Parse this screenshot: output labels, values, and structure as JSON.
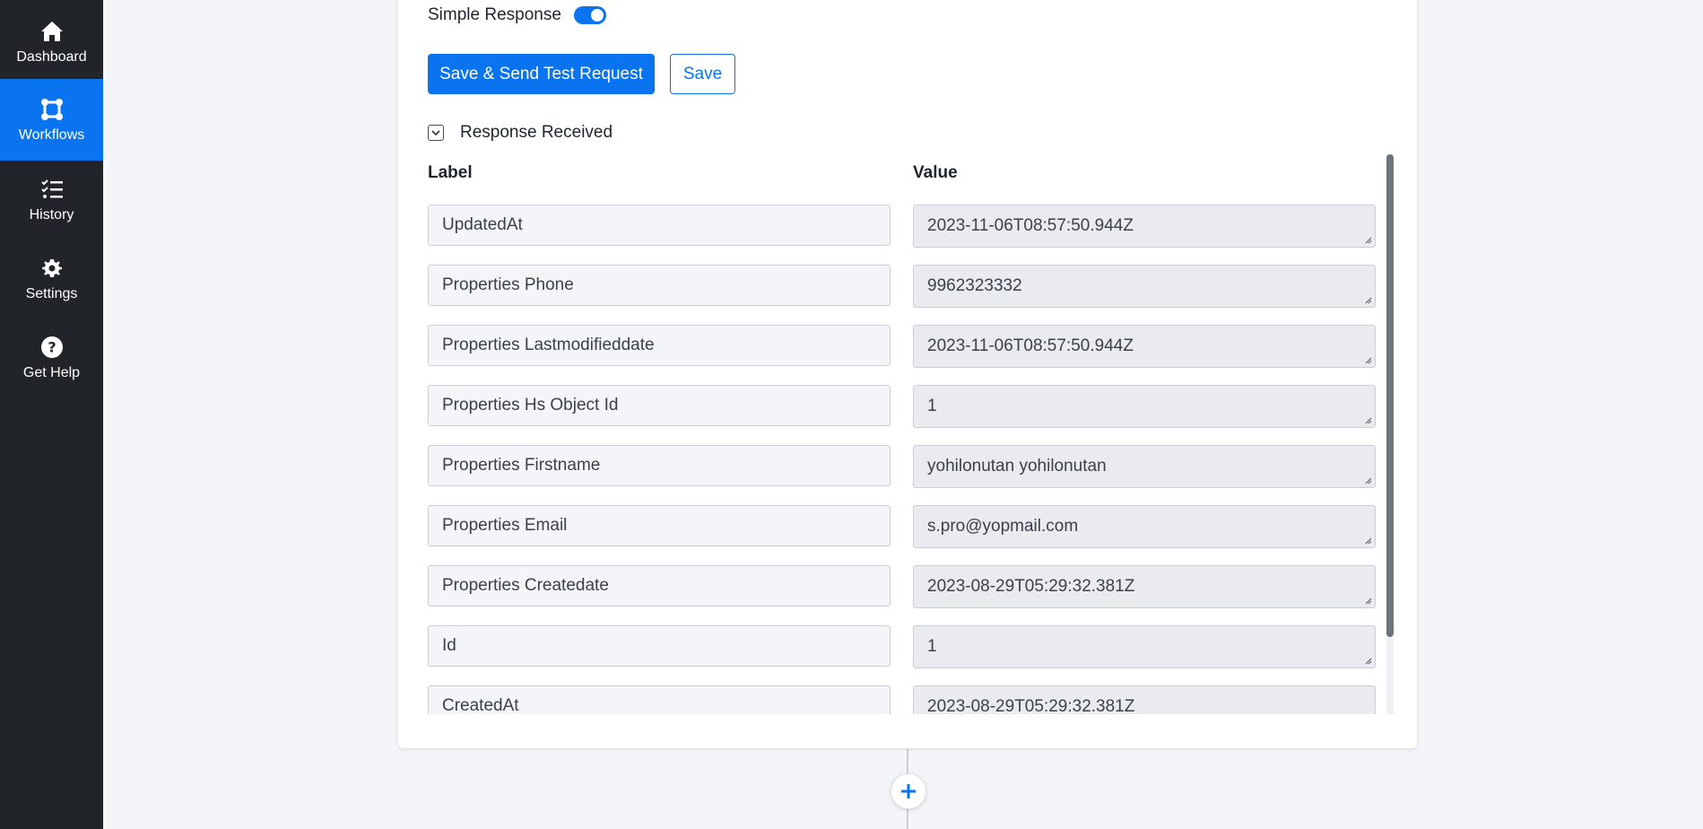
{
  "sidebar": {
    "items": [
      {
        "label": "Dashboard",
        "icon": "home-icon",
        "active": false
      },
      {
        "label": "Workflows",
        "icon": "workflows-icon",
        "active": true
      },
      {
        "label": "History",
        "icon": "history-icon",
        "active": false
      },
      {
        "label": "Settings",
        "icon": "gear-icon",
        "active": false
      },
      {
        "label": "Get Help",
        "icon": "help-icon",
        "active": false
      }
    ],
    "active_color": "#0a73f0",
    "background": "#212529"
  },
  "form": {
    "simple_response_label": "Simple Response",
    "simple_response_on": true,
    "save_send_label": "Save & Send Test Request",
    "save_label": "Save",
    "response_received_label": "Response Received"
  },
  "table": {
    "headers": {
      "label": "Label",
      "value": "Value"
    },
    "rows": [
      {
        "label": "UpdatedAt",
        "value": "2023-11-06T08:57:50.944Z"
      },
      {
        "label": "Properties Phone",
        "value": "9962323332"
      },
      {
        "label": "Properties Lastmodifieddate",
        "value": "2023-11-06T08:57:50.944Z"
      },
      {
        "label": "Properties Hs Object Id",
        "value": "1"
      },
      {
        "label": "Properties Firstname",
        "value": "yohilonutan yohilonutan"
      },
      {
        "label": "Properties Email",
        "value": "s.pro@yopmail.com"
      },
      {
        "label": "Properties Createdate",
        "value": "2023-08-29T05:29:32.381Z"
      },
      {
        "label": "Id",
        "value": "1"
      },
      {
        "label": "CreatedAt",
        "value": "2023-08-29T05:29:32.381Z"
      }
    ]
  },
  "colors": {
    "accent": "#0a73f0"
  }
}
